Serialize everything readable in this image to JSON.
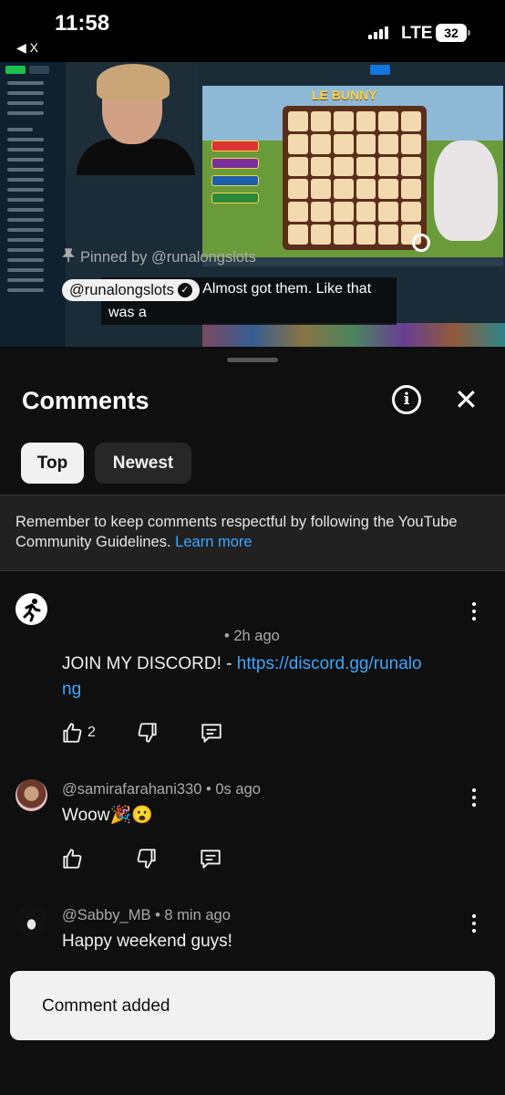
{
  "status_bar": {
    "time": "11:58",
    "back_label": "◀ X",
    "network": "LTE",
    "battery": "32"
  },
  "video": {
    "caption": "Discord Sash. Almost got them. Like that was a",
    "game_logo": "LE BUNNY"
  },
  "sheet": {
    "title": "Comments",
    "info_icon": "info-icon",
    "close_icon": "close-icon",
    "tabs": [
      {
        "label": "Top",
        "selected": true
      },
      {
        "label": "Newest",
        "selected": false
      }
    ],
    "notice": {
      "text": "Remember to keep comments respectful by following the YouTube Community Guidelines.",
      "link": "Learn more"
    }
  },
  "comments": [
    {
      "pinned_label": "Pinned by @runalongslots",
      "author": "@runalongslots",
      "time": "• 2h ago",
      "text": "JOIN MY DISCORD! - ",
      "link": "https://discord.gg/runalong",
      "likes": "2"
    },
    {
      "author": "@samirafarahani330",
      "time": "• 0s ago",
      "text": "Woow🎉😮"
    },
    {
      "author": "@Sabby_MB",
      "time": "• 8 min ago",
      "text": "Happy weekend guys!"
    }
  ],
  "toast": {
    "text": "Comment added"
  },
  "colors": {
    "background": "#0f0f0f",
    "link": "#3ea6ff",
    "chip_selected": "#f1f1f1",
    "chip": "#272727"
  }
}
